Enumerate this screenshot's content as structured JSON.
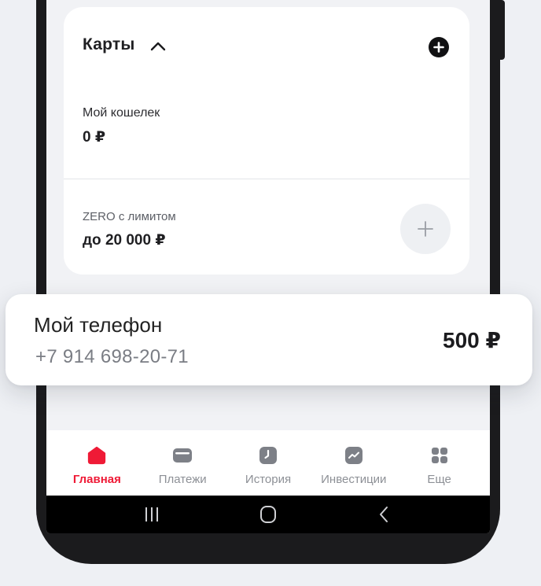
{
  "cards": {
    "title": "Карты",
    "wallet": {
      "label": "Мой кошелек",
      "amount": "0 ₽"
    },
    "zero": {
      "label": "ZERO с лимитом",
      "amount": "до 20 000 ₽"
    }
  },
  "phone_card": {
    "title": "Мой телефон",
    "number": "+7 914 698-20-71",
    "balance": "500 ₽"
  },
  "tabbar": {
    "tabs": [
      {
        "label": "Главная",
        "icon": "home-icon",
        "active": true
      },
      {
        "label": "Платежи",
        "icon": "wallet-icon",
        "active": false
      },
      {
        "label": "История",
        "icon": "clock-icon",
        "active": false
      },
      {
        "label": "Инвестиции",
        "icon": "chart-icon",
        "active": false
      },
      {
        "label": "Еще",
        "icon": "grid-icon",
        "active": false
      }
    ]
  },
  "colors": {
    "accent": "#ef1a36",
    "inactive": "#8d9096",
    "background": "#eef0f4"
  }
}
